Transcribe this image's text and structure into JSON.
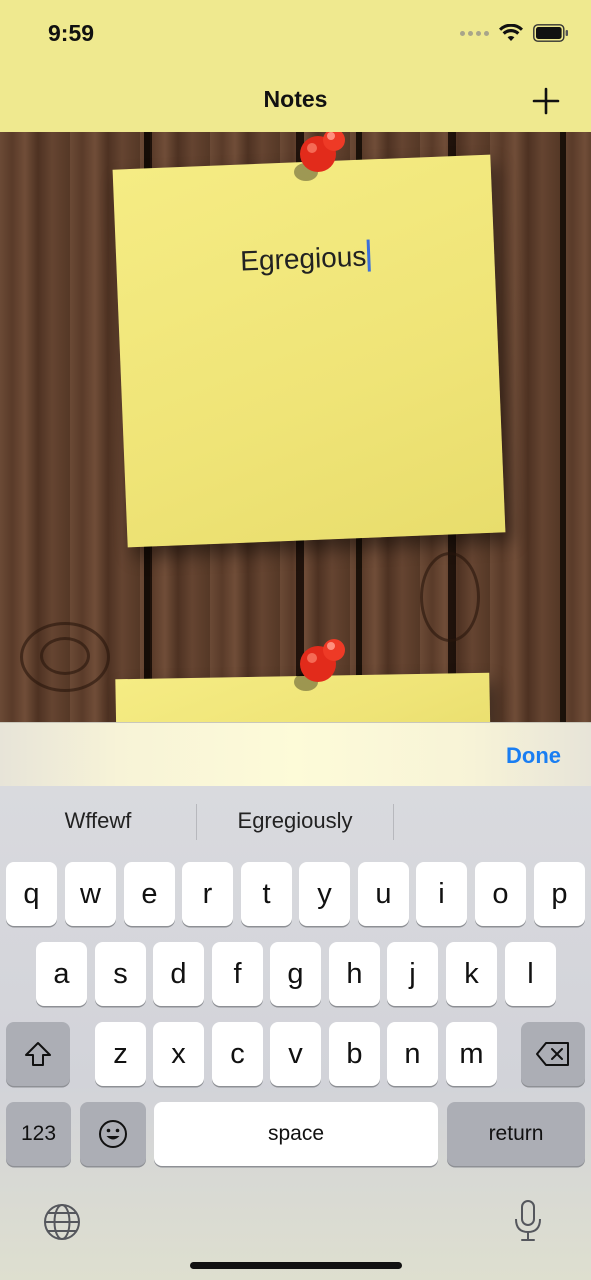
{
  "status": {
    "time": "9:59"
  },
  "nav": {
    "title": "Notes",
    "add_icon": "plus-icon"
  },
  "notes": [
    {
      "text": "Egregious",
      "editing": true
    },
    {
      "text": "",
      "editing": false
    }
  ],
  "accessory": {
    "done_label": "Done"
  },
  "keyboard": {
    "suggestions": [
      "Wffewf",
      "Egregiously",
      ""
    ],
    "row1": [
      "q",
      "w",
      "e",
      "r",
      "t",
      "y",
      "u",
      "i",
      "o",
      "p"
    ],
    "row2": [
      "a",
      "s",
      "d",
      "f",
      "g",
      "h",
      "j",
      "k",
      "l"
    ],
    "row3": [
      "z",
      "x",
      "c",
      "v",
      "b",
      "n",
      "m"
    ],
    "numbers_label": "123",
    "space_label": "space",
    "return_label": "return"
  },
  "colors": {
    "header_bg": "#efe98f",
    "note_yellow": "#f2e87e",
    "accent_blue": "#1a7ef2",
    "pin_red": "#e52b1c"
  }
}
